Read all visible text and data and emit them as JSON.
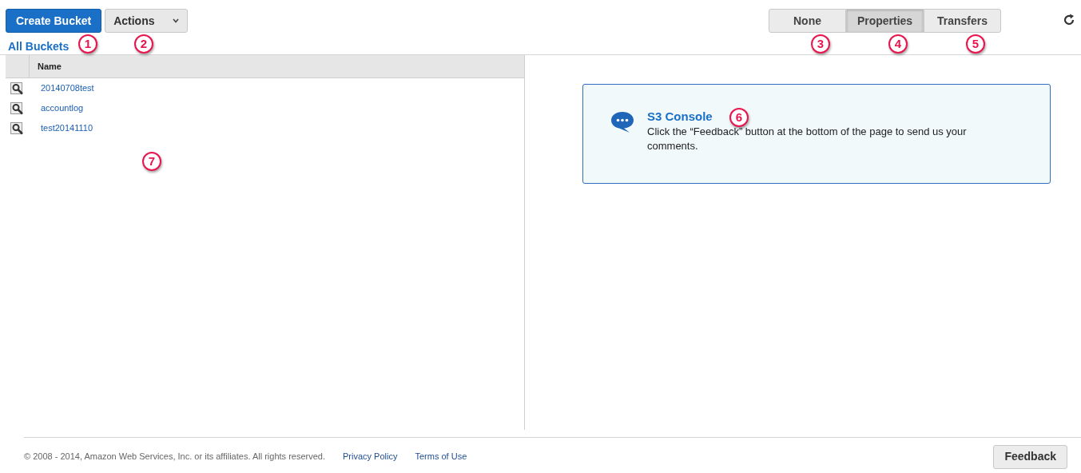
{
  "toolbar": {
    "create_button": "Create Bucket",
    "actions_button": "Actions",
    "view_tabs": [
      {
        "label": "None",
        "selected": false
      },
      {
        "label": "Properties",
        "selected": true
      },
      {
        "label": "Transfers",
        "selected": false
      }
    ]
  },
  "breadcrumb": "All Buckets",
  "table": {
    "columns": [
      "Name"
    ],
    "rows": [
      {
        "name": "20140708test"
      },
      {
        "name": "accountlog"
      },
      {
        "name": "test20141110"
      }
    ]
  },
  "info_panel": {
    "title": "S3 Console",
    "text": "Click the “Feedback” button at the bottom of the page to send us your comments."
  },
  "footer": {
    "copyright": "© 2008 - 2014, Amazon Web Services, Inc. or its affiliates. All rights reserved.",
    "links": [
      "Privacy Policy",
      "Terms of Use"
    ],
    "feedback_button": "Feedback"
  },
  "markers": [
    "1",
    "2",
    "3",
    "4",
    "5",
    "6",
    "7"
  ]
}
